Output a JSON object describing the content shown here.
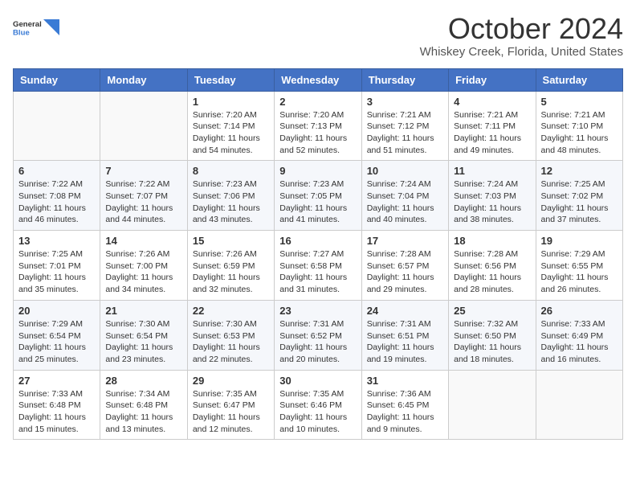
{
  "logo": {
    "general": "General",
    "blue": "Blue"
  },
  "title": "October 2024",
  "location": "Whiskey Creek, Florida, United States",
  "days_header": [
    "Sunday",
    "Monday",
    "Tuesday",
    "Wednesday",
    "Thursday",
    "Friday",
    "Saturday"
  ],
  "weeks": [
    [
      {
        "day": "",
        "info": ""
      },
      {
        "day": "",
        "info": ""
      },
      {
        "day": "1",
        "info": "Sunrise: 7:20 AM\nSunset: 7:14 PM\nDaylight: 11 hours and 54 minutes."
      },
      {
        "day": "2",
        "info": "Sunrise: 7:20 AM\nSunset: 7:13 PM\nDaylight: 11 hours and 52 minutes."
      },
      {
        "day": "3",
        "info": "Sunrise: 7:21 AM\nSunset: 7:12 PM\nDaylight: 11 hours and 51 minutes."
      },
      {
        "day": "4",
        "info": "Sunrise: 7:21 AM\nSunset: 7:11 PM\nDaylight: 11 hours and 49 minutes."
      },
      {
        "day": "5",
        "info": "Sunrise: 7:21 AM\nSunset: 7:10 PM\nDaylight: 11 hours and 48 minutes."
      }
    ],
    [
      {
        "day": "6",
        "info": "Sunrise: 7:22 AM\nSunset: 7:08 PM\nDaylight: 11 hours and 46 minutes."
      },
      {
        "day": "7",
        "info": "Sunrise: 7:22 AM\nSunset: 7:07 PM\nDaylight: 11 hours and 44 minutes."
      },
      {
        "day": "8",
        "info": "Sunrise: 7:23 AM\nSunset: 7:06 PM\nDaylight: 11 hours and 43 minutes."
      },
      {
        "day": "9",
        "info": "Sunrise: 7:23 AM\nSunset: 7:05 PM\nDaylight: 11 hours and 41 minutes."
      },
      {
        "day": "10",
        "info": "Sunrise: 7:24 AM\nSunset: 7:04 PM\nDaylight: 11 hours and 40 minutes."
      },
      {
        "day": "11",
        "info": "Sunrise: 7:24 AM\nSunset: 7:03 PM\nDaylight: 11 hours and 38 minutes."
      },
      {
        "day": "12",
        "info": "Sunrise: 7:25 AM\nSunset: 7:02 PM\nDaylight: 11 hours and 37 minutes."
      }
    ],
    [
      {
        "day": "13",
        "info": "Sunrise: 7:25 AM\nSunset: 7:01 PM\nDaylight: 11 hours and 35 minutes."
      },
      {
        "day": "14",
        "info": "Sunrise: 7:26 AM\nSunset: 7:00 PM\nDaylight: 11 hours and 34 minutes."
      },
      {
        "day": "15",
        "info": "Sunrise: 7:26 AM\nSunset: 6:59 PM\nDaylight: 11 hours and 32 minutes."
      },
      {
        "day": "16",
        "info": "Sunrise: 7:27 AM\nSunset: 6:58 PM\nDaylight: 11 hours and 31 minutes."
      },
      {
        "day": "17",
        "info": "Sunrise: 7:28 AM\nSunset: 6:57 PM\nDaylight: 11 hours and 29 minutes."
      },
      {
        "day": "18",
        "info": "Sunrise: 7:28 AM\nSunset: 6:56 PM\nDaylight: 11 hours and 28 minutes."
      },
      {
        "day": "19",
        "info": "Sunrise: 7:29 AM\nSunset: 6:55 PM\nDaylight: 11 hours and 26 minutes."
      }
    ],
    [
      {
        "day": "20",
        "info": "Sunrise: 7:29 AM\nSunset: 6:54 PM\nDaylight: 11 hours and 25 minutes."
      },
      {
        "day": "21",
        "info": "Sunrise: 7:30 AM\nSunset: 6:54 PM\nDaylight: 11 hours and 23 minutes."
      },
      {
        "day": "22",
        "info": "Sunrise: 7:30 AM\nSunset: 6:53 PM\nDaylight: 11 hours and 22 minutes."
      },
      {
        "day": "23",
        "info": "Sunrise: 7:31 AM\nSunset: 6:52 PM\nDaylight: 11 hours and 20 minutes."
      },
      {
        "day": "24",
        "info": "Sunrise: 7:31 AM\nSunset: 6:51 PM\nDaylight: 11 hours and 19 minutes."
      },
      {
        "day": "25",
        "info": "Sunrise: 7:32 AM\nSunset: 6:50 PM\nDaylight: 11 hours and 18 minutes."
      },
      {
        "day": "26",
        "info": "Sunrise: 7:33 AM\nSunset: 6:49 PM\nDaylight: 11 hours and 16 minutes."
      }
    ],
    [
      {
        "day": "27",
        "info": "Sunrise: 7:33 AM\nSunset: 6:48 PM\nDaylight: 11 hours and 15 minutes."
      },
      {
        "day": "28",
        "info": "Sunrise: 7:34 AM\nSunset: 6:48 PM\nDaylight: 11 hours and 13 minutes."
      },
      {
        "day": "29",
        "info": "Sunrise: 7:35 AM\nSunset: 6:47 PM\nDaylight: 11 hours and 12 minutes."
      },
      {
        "day": "30",
        "info": "Sunrise: 7:35 AM\nSunset: 6:46 PM\nDaylight: 11 hours and 10 minutes."
      },
      {
        "day": "31",
        "info": "Sunrise: 7:36 AM\nSunset: 6:45 PM\nDaylight: 11 hours and 9 minutes."
      },
      {
        "day": "",
        "info": ""
      },
      {
        "day": "",
        "info": ""
      }
    ]
  ]
}
